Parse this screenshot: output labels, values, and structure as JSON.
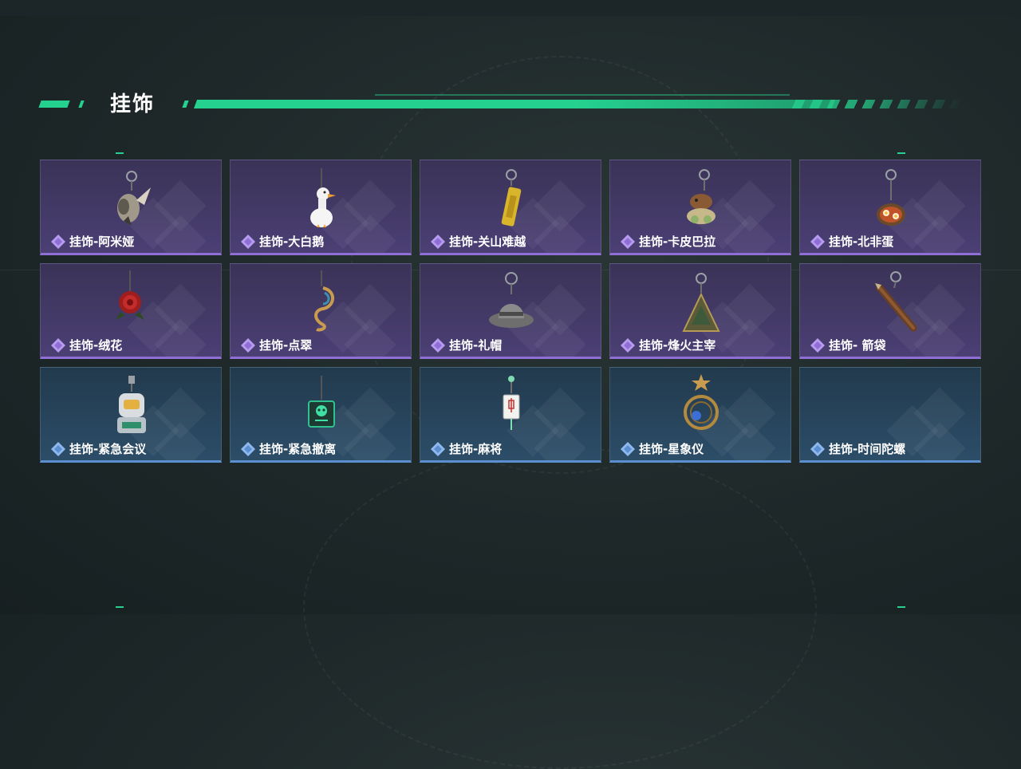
{
  "header": {
    "title": "挂饰"
  },
  "colors": {
    "accent": "#25d18f",
    "purple_rarity": "#8f6fd6",
    "blue_rarity": "#5b8fd0"
  },
  "items": [
    {
      "label": "挂饰-阿米娅",
      "rarity": "purple",
      "icon": "bird-charm-icon"
    },
    {
      "label": "挂饰-大白鹅",
      "rarity": "purple",
      "icon": "goose-charm-icon"
    },
    {
      "label": "挂饰-关山难越",
      "rarity": "purple",
      "icon": "gold-bar-charm-icon"
    },
    {
      "label": "挂饰-卡皮巴拉",
      "rarity": "purple",
      "icon": "capybara-charm-icon"
    },
    {
      "label": "挂饰-北非蛋",
      "rarity": "purple",
      "icon": "shakshuka-charm-icon"
    },
    {
      "label": "挂饰-绒花",
      "rarity": "purple",
      "icon": "red-flower-charm-icon"
    },
    {
      "label": "挂饰-点翠",
      "rarity": "purple",
      "icon": "phoenix-charm-icon"
    },
    {
      "label": "挂饰-礼帽",
      "rarity": "purple",
      "icon": "hat-charm-icon"
    },
    {
      "label": "挂饰-烽火主宰",
      "rarity": "purple",
      "icon": "pyramid-charm-icon"
    },
    {
      "label": "挂饰- 箭袋",
      "rarity": "purple",
      "icon": "quiver-charm-icon"
    },
    {
      "label": "挂饰-紧急会议",
      "rarity": "blue",
      "icon": "robot-charm-icon"
    },
    {
      "label": "挂饰-紧急撤离",
      "rarity": "blue",
      "icon": "skull-box-charm-icon"
    },
    {
      "label": "挂饰-麻将",
      "rarity": "blue",
      "icon": "mahjong-tile-charm-icon"
    },
    {
      "label": "挂饰-星象仪",
      "rarity": "blue",
      "icon": "astrolabe-charm-icon"
    },
    {
      "label": "挂饰-时间陀螺",
      "rarity": "blue",
      "icon": "empty-slot-icon"
    }
  ]
}
